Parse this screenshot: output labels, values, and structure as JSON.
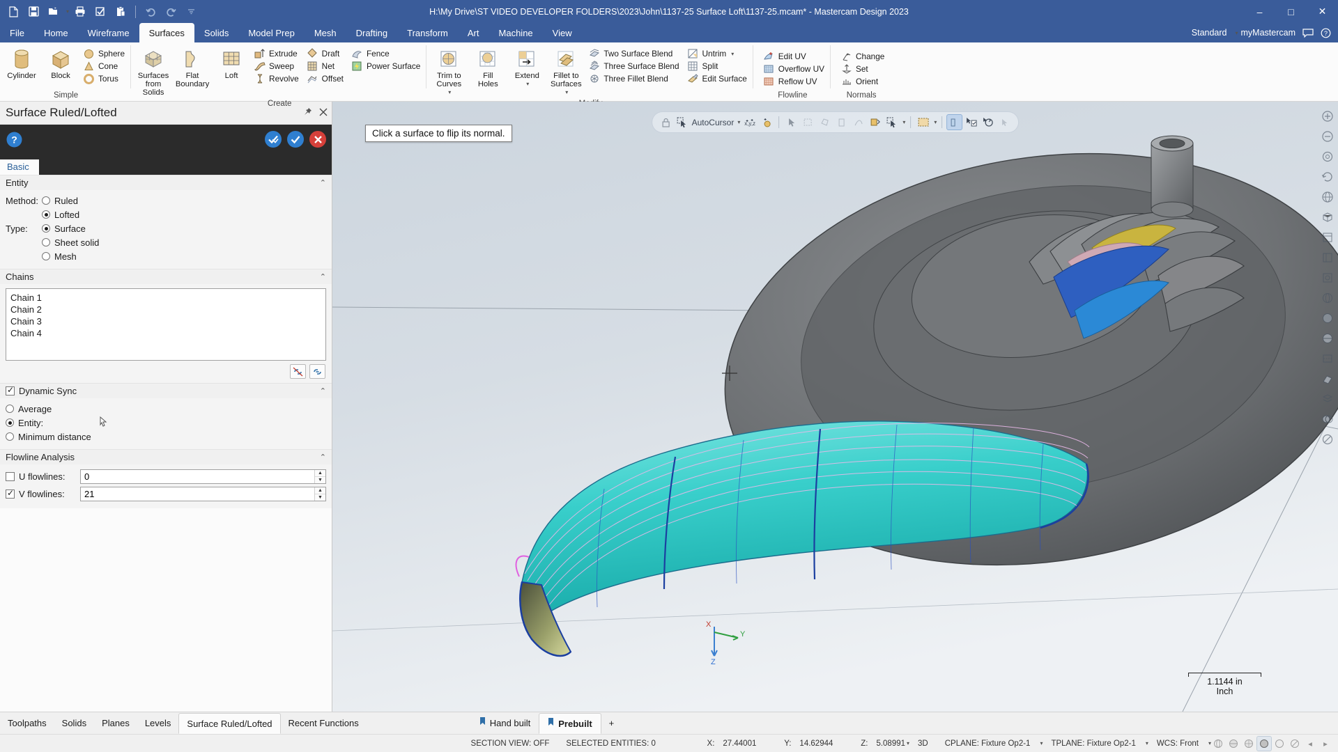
{
  "titlebar": {
    "document_title": "H:\\My Drive\\ST VIDEO DEVELOPER FOLDERS\\2023\\John\\1137-25 Surface Loft\\1137-25.mcam* - Mastercam Design 2023",
    "quick_access": [
      {
        "name": "new-file-icon",
        "label": "New"
      },
      {
        "name": "save-icon",
        "label": "Save"
      },
      {
        "name": "open-folder-icon",
        "label": "Open"
      },
      {
        "name": "print-icon",
        "label": "Print"
      },
      {
        "name": "print-preview-icon",
        "label": "Print Preview"
      },
      {
        "name": "paste-icon",
        "label": "Paste"
      },
      {
        "name": "undo-icon",
        "label": "Undo"
      },
      {
        "name": "redo-icon",
        "label": "Redo"
      },
      {
        "name": "customize-qat-icon",
        "label": "Customize Quick Access Toolbar"
      }
    ],
    "window_buttons": {
      "minimize": "–",
      "maximize": "□",
      "close": "✕"
    }
  },
  "ribbon": {
    "tabs": [
      {
        "label": "File",
        "active": false
      },
      {
        "label": "Home",
        "active": false
      },
      {
        "label": "Wireframe",
        "active": false
      },
      {
        "label": "Surfaces",
        "active": true
      },
      {
        "label": "Solids",
        "active": false
      },
      {
        "label": "Model Prep",
        "active": false
      },
      {
        "label": "Mesh",
        "active": false
      },
      {
        "label": "Drafting",
        "active": false
      },
      {
        "label": "Transform",
        "active": false
      },
      {
        "label": "Art",
        "active": false
      },
      {
        "label": "Machine",
        "active": false
      },
      {
        "label": "View",
        "active": false
      }
    ],
    "right": {
      "config_label": "Standard",
      "account_label": "myMastercam",
      "chat_icon": "chat-icon",
      "help_icon": "help-icon"
    },
    "groups": [
      {
        "title": "Simple",
        "big": [
          {
            "label": "Cylinder",
            "icon": "cylinder-icon"
          },
          {
            "label": "Block",
            "icon": "block-icon"
          }
        ],
        "small": [
          {
            "label": "Sphere",
            "icon": "sphere-icon"
          },
          {
            "label": "Cone",
            "icon": "cone-icon"
          },
          {
            "label": "Torus",
            "icon": "torus-icon"
          }
        ]
      },
      {
        "title": "Create",
        "big": [
          {
            "label": "Surfaces\nfrom Solids",
            "icon": "surfaces-from-solids-icon"
          },
          {
            "label": "Flat\nBoundary",
            "icon": "flat-boundary-icon"
          },
          {
            "label": "Loft",
            "icon": "loft-icon"
          }
        ],
        "small_a": [
          {
            "label": "Extrude",
            "icon": "extrude-icon"
          },
          {
            "label": "Sweep",
            "icon": "sweep-icon"
          },
          {
            "label": "Revolve",
            "icon": "revolve-icon"
          }
        ],
        "small_b": [
          {
            "label": "Draft",
            "icon": "draft-icon"
          },
          {
            "label": "Net",
            "icon": "net-icon"
          },
          {
            "label": "Offset",
            "icon": "offset-icon"
          }
        ],
        "small_c": [
          {
            "label": "Fence",
            "icon": "fence-icon"
          },
          {
            "label": "Power Surface",
            "icon": "power-surface-icon"
          }
        ]
      },
      {
        "title": "Modify",
        "big": [
          {
            "label": "Trim to\nCurves",
            "icon": "trim-to-curves-icon",
            "dropdown": true
          },
          {
            "label": "Fill\nHoles",
            "icon": "fill-holes-icon"
          },
          {
            "label": "Extend",
            "icon": "extend-icon",
            "dropdown": true
          },
          {
            "label": "Fillet to\nSurfaces",
            "icon": "fillet-to-surfaces-icon",
            "dropdown": true
          }
        ],
        "small_a": [
          {
            "label": "Two Surface Blend",
            "icon": "two-surface-blend-icon"
          },
          {
            "label": "Three Surface Blend",
            "icon": "three-surface-blend-icon"
          },
          {
            "label": "Three Fillet Blend",
            "icon": "three-fillet-blend-icon"
          }
        ],
        "small_b": [
          {
            "label": "Untrim",
            "icon": "untrim-icon",
            "dropdown": true
          },
          {
            "label": "Split",
            "icon": "split-icon"
          },
          {
            "label": "Edit Surface",
            "icon": "edit-surface-icon"
          }
        ]
      },
      {
        "title": "Flowline",
        "small_a": [
          {
            "label": "Edit UV",
            "icon": "edit-uv-icon"
          },
          {
            "label": "Overflow UV",
            "icon": "overflow-uv-icon"
          },
          {
            "label": "Reflow UV",
            "icon": "reflow-uv-icon"
          }
        ]
      },
      {
        "title": "Normals",
        "small_a": [
          {
            "label": "Change",
            "icon": "change-normals-icon"
          },
          {
            "label": "Set",
            "icon": "set-normals-icon"
          },
          {
            "label": "Orient",
            "icon": "orient-normals-icon"
          }
        ]
      }
    ]
  },
  "panel": {
    "title": "Surface Ruled/Lofted",
    "pin_icon": "pin-icon",
    "close_icon": "close-icon",
    "help_icon": "help-icon",
    "ok_icon": "ok-check-icon",
    "apply_icon": "apply-check-icon",
    "cancel_icon": "cancel-x-icon",
    "tabs": [
      {
        "label": "Basic",
        "active": true
      }
    ],
    "entity": {
      "section_label": "Entity",
      "method_label": "Method:",
      "method_options": [
        {
          "label": "Ruled",
          "selected": false
        },
        {
          "label": "Lofted",
          "selected": true
        }
      ],
      "type_label": "Type:",
      "type_options": [
        {
          "label": "Surface",
          "selected": true
        },
        {
          "label": "Sheet solid",
          "selected": false
        },
        {
          "label": "Mesh",
          "selected": false
        }
      ]
    },
    "chains": {
      "section_label": "Chains",
      "items": [
        "Chain  1",
        "Chain  2",
        "Chain  3",
        "Chain  4"
      ],
      "tools": [
        {
          "name": "reselect-chain-icon",
          "label": "Reselect"
        },
        {
          "name": "select-chain-icon",
          "label": "Select chain"
        }
      ]
    },
    "dynamic_sync": {
      "label": "Dynamic Sync",
      "checked": true,
      "options": [
        {
          "label": "Average",
          "selected": false
        },
        {
          "label": "Entity:",
          "selected": true
        },
        {
          "label": "Minimum distance",
          "selected": false
        }
      ],
      "entity_picker_icon": "cursor-pick-icon"
    },
    "flowline": {
      "section_label": "Flowline Analysis",
      "u_label": "U flowlines:",
      "u_checked": false,
      "u_value": "0",
      "v_label": "V flowlines:",
      "v_checked": true,
      "v_value": "21"
    }
  },
  "viewport": {
    "prompt": "Click a surface to flip its normal.",
    "selection_bar": {
      "lock_icon": "lock-icon",
      "autocursor_label": "AutoCursor",
      "autocursor_icon": "autocursor-icon",
      "xyz_icon": "xyz-coords-icon",
      "point-icon": "point-snap-icon",
      "icons": [
        "arrow-select-icon",
        "window-select-icon",
        "polygon-select-icon",
        "single-select-icon",
        "vector-select-icon",
        "solid-select-icon",
        "entity-select-icon",
        "marquee-select-icon",
        "quick-mask-icon",
        "verify-select-icon",
        "refresh-select-icon",
        "end-select-icon"
      ]
    },
    "right_rail": [
      "fit-icon",
      "unzoom-icon",
      "zoom-target-icon",
      "dynamic-rotate-icon",
      "gview-icon",
      "isometric-icon",
      "top-view-icon",
      "front-view-icon",
      "right-view-icon",
      "wireframe-icon",
      "shaded-icon",
      "shaded-wireframe-icon",
      "hidden-line-icon",
      "section-view-icon",
      "levels-icon",
      "translucency-icon",
      "blank-icon"
    ],
    "gnomon": {
      "x": "X",
      "y": "Y",
      "z": "Z"
    },
    "scale": {
      "value": "1.1144 in",
      "unit": "Inch"
    }
  },
  "bottom_tabs": {
    "left": [
      {
        "label": "Toolpaths",
        "active": false
      },
      {
        "label": "Solids",
        "active": false
      },
      {
        "label": "Planes",
        "active": false
      },
      {
        "label": "Levels",
        "active": false
      },
      {
        "label": "Surface Ruled/Lofted",
        "active": true
      },
      {
        "label": "Recent Functions",
        "active": false
      }
    ],
    "files": [
      {
        "label": "Hand built",
        "active": false,
        "icon": "file-tab-icon"
      },
      {
        "label": "Prebuilt",
        "active": true,
        "icon": "file-tab-icon"
      }
    ],
    "add_label": "+"
  },
  "status_bar": {
    "section_view": "SECTION VIEW: OFF",
    "selected_entities": "SELECTED ENTITIES: 0",
    "x_label": "X:",
    "x_value": "27.44001",
    "y_label": "Y:",
    "y_value": "14.62944",
    "z_label": "Z:",
    "z_value": "5.08991",
    "mode": "3D",
    "cplane": "CPLANE: Fixture Op2-1",
    "tplane": "TPLANE: Fixture Op2-1",
    "wcs": "WCS: Front",
    "right_icons": [
      "wireframe-status-icon",
      "shaded-status-icon",
      "shaded-wire-status-icon",
      "material-status-icon",
      "translucent-status-icon",
      "no-shade-status-icon"
    ],
    "nav_left": "◂",
    "nav_right": "▸"
  },
  "colors": {
    "titlebar": "#3a5c9a",
    "ribbon_bg": "#fbfbfb",
    "panel_dark": "#2b2b2b",
    "accent_blue": "#2a6099",
    "surface_cyan": "#3fd2cf",
    "ok_green": "#3aa23a",
    "cancel_red": "#d6403a"
  }
}
